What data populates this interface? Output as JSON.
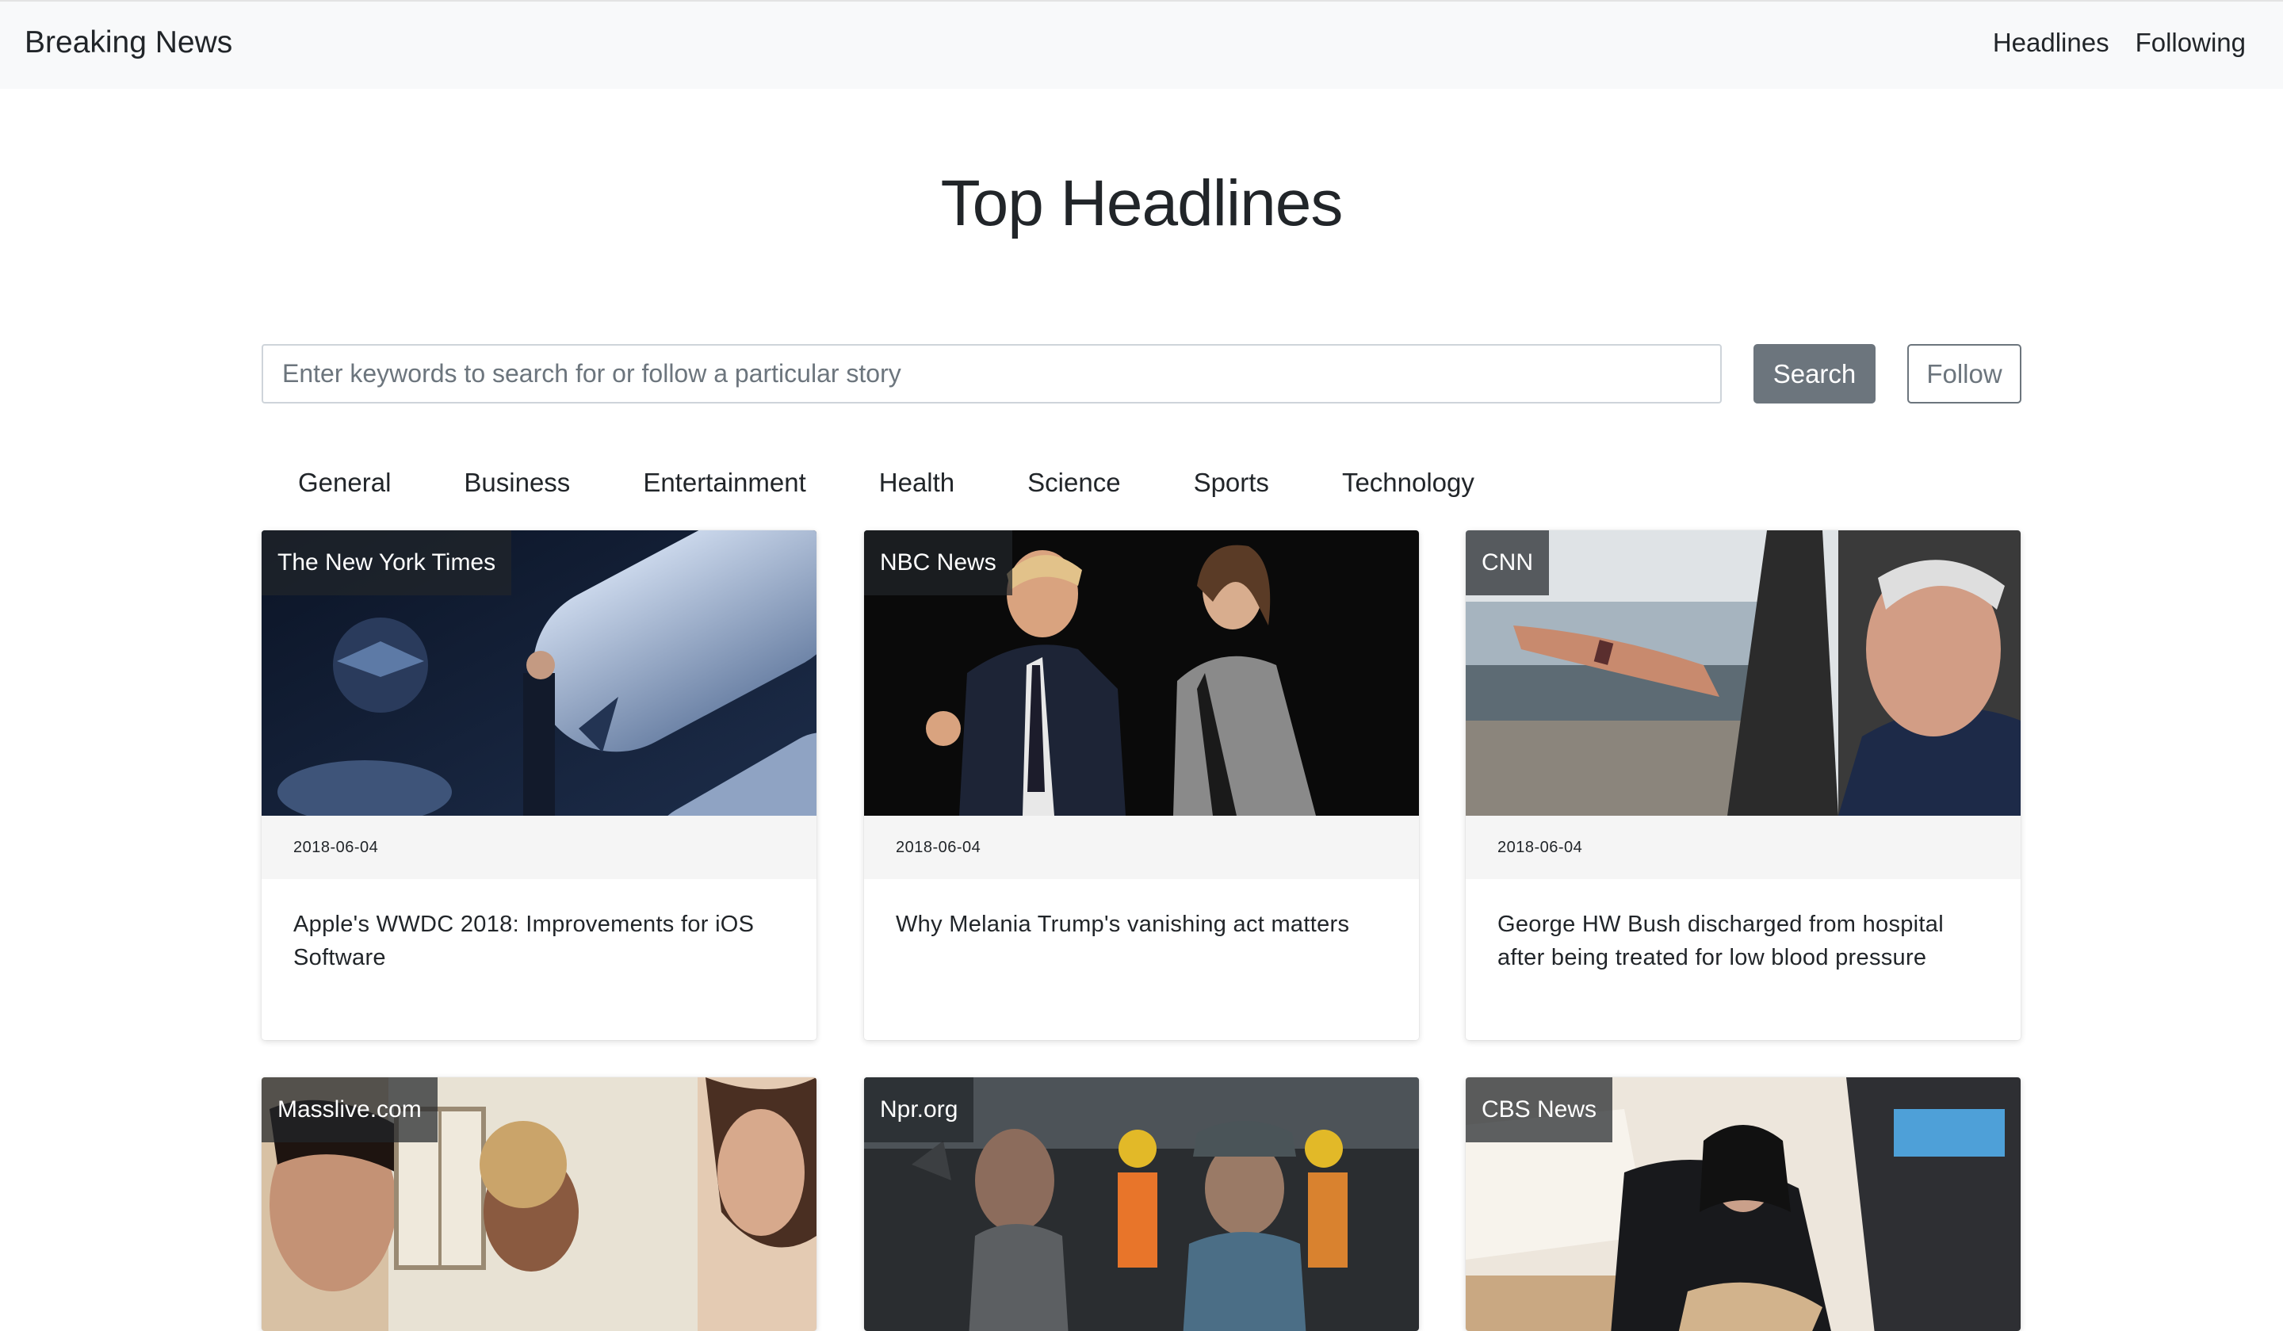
{
  "navbar": {
    "brand": "Breaking News",
    "links": [
      "Headlines",
      "Following"
    ]
  },
  "page": {
    "title": "Top Headlines"
  },
  "search": {
    "placeholder": "Enter keywords to search for or follow a particular story",
    "search_label": "Search",
    "follow_label": "Follow"
  },
  "categories": [
    "General",
    "Business",
    "Entertainment",
    "Health",
    "Science",
    "Sports",
    "Technology"
  ],
  "articles": [
    {
      "source": "The New York Times",
      "date": "2018-06-04",
      "title": "Apple's WWDC 2018: Improvements for iOS Software"
    },
    {
      "source": "NBC News",
      "date": "2018-06-04",
      "title": "Why Melania Trump's vanishing act matters"
    },
    {
      "source": "CNN",
      "date": "2018-06-04",
      "title": "George HW Bush discharged from hospital after being treated for low blood pressure"
    },
    {
      "source": "Masslive.com"
    },
    {
      "source": "Npr.org"
    },
    {
      "source": "CBS News"
    }
  ],
  "colors": {
    "navbar_bg": "#f8f9fa",
    "secondary": "#6c757d",
    "text": "#212529",
    "date_bar_bg": "#f5f5f5"
  }
}
